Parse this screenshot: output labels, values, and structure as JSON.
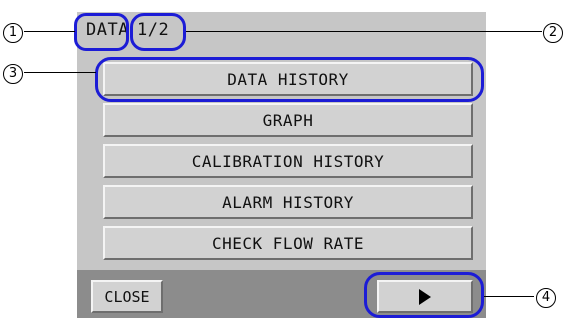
{
  "header": {
    "title": "DATA",
    "page_indicator": "1/2"
  },
  "menu": {
    "items": [
      {
        "label": "DATA HISTORY"
      },
      {
        "label": "GRAPH"
      },
      {
        "label": "CALIBRATION HISTORY"
      },
      {
        "label": "ALARM HISTORY"
      },
      {
        "label": "CHECK FLOW RATE"
      }
    ]
  },
  "footer": {
    "close_label": "CLOSE",
    "next_icon": "triangle-right-icon"
  },
  "callouts": [
    "1",
    "2",
    "3",
    "4"
  ],
  "colors": {
    "screen_bg": "#c6c6c6",
    "button_bg": "#d2d2d2",
    "footer_bg": "#8c8c8c",
    "callout_outline": "#1c1cd6"
  }
}
